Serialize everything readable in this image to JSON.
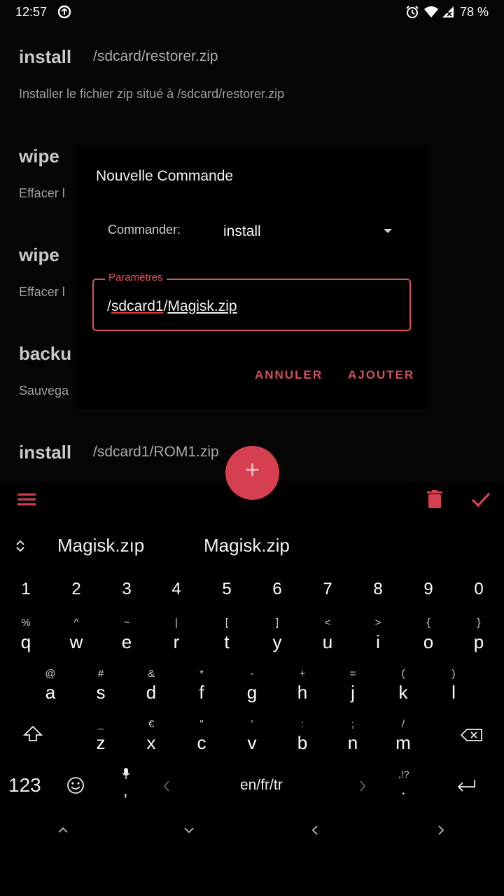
{
  "status_bar": {
    "time": "12:57",
    "battery": "78 %"
  },
  "list": [
    {
      "command": "install",
      "param": "/sdcard/restorer.zip",
      "description": "Installer le fichier zip situé à /sdcard/restorer.zip"
    },
    {
      "command": "wipe",
      "param": "",
      "description": "Effacer l"
    },
    {
      "command": "wipe",
      "param": "",
      "description": "Effacer l"
    },
    {
      "command": "backu",
      "param": "",
      "description": "Sauvega"
    },
    {
      "command": "install",
      "param": "/sdcard1/ROM1.zip",
      "description": ""
    }
  ],
  "dialog": {
    "title": "Nouvelle Commande",
    "command_label": "Commander:",
    "command_value": "install",
    "params_label": "Paramètres",
    "params_value_part1": "sdcard1",
    "params_value_part2": "Magisk.zip",
    "cancel": "ANNULER",
    "add": "AJOUTER"
  },
  "fab": {
    "label": "+"
  },
  "accent_color": "#d53f4f",
  "keyboard": {
    "suggestions": [
      "Magisk.zıp",
      "Magisk.zip"
    ],
    "numbers": [
      "1",
      "2",
      "3",
      "4",
      "5",
      "6",
      "7",
      "8",
      "9",
      "0"
    ],
    "row1": {
      "letters": [
        "q",
        "w",
        "e",
        "r",
        "t",
        "y",
        "u",
        "i",
        "o",
        "p"
      ],
      "hints": [
        "%",
        "^",
        "~",
        "|",
        "[",
        "]",
        "<",
        ">",
        "{",
        "}"
      ]
    },
    "row2": {
      "letters": [
        "a",
        "s",
        "d",
        "f",
        "g",
        "h",
        "j",
        "k",
        "l"
      ],
      "hints": [
        "@",
        "#",
        "&",
        "*",
        "-",
        "+",
        "=",
        "(",
        ")"
      ]
    },
    "row3": {
      "letters": [
        "z",
        "x",
        "c",
        "v",
        "b",
        "n",
        "m"
      ],
      "hints": [
        "_",
        "€",
        "\"",
        "'",
        ":",
        ";",
        "/"
      ]
    },
    "symbols_key": "123",
    "space_label": "en/fr/tr",
    "comma": ",",
    "period": ".",
    "period_hint": ",!?"
  }
}
